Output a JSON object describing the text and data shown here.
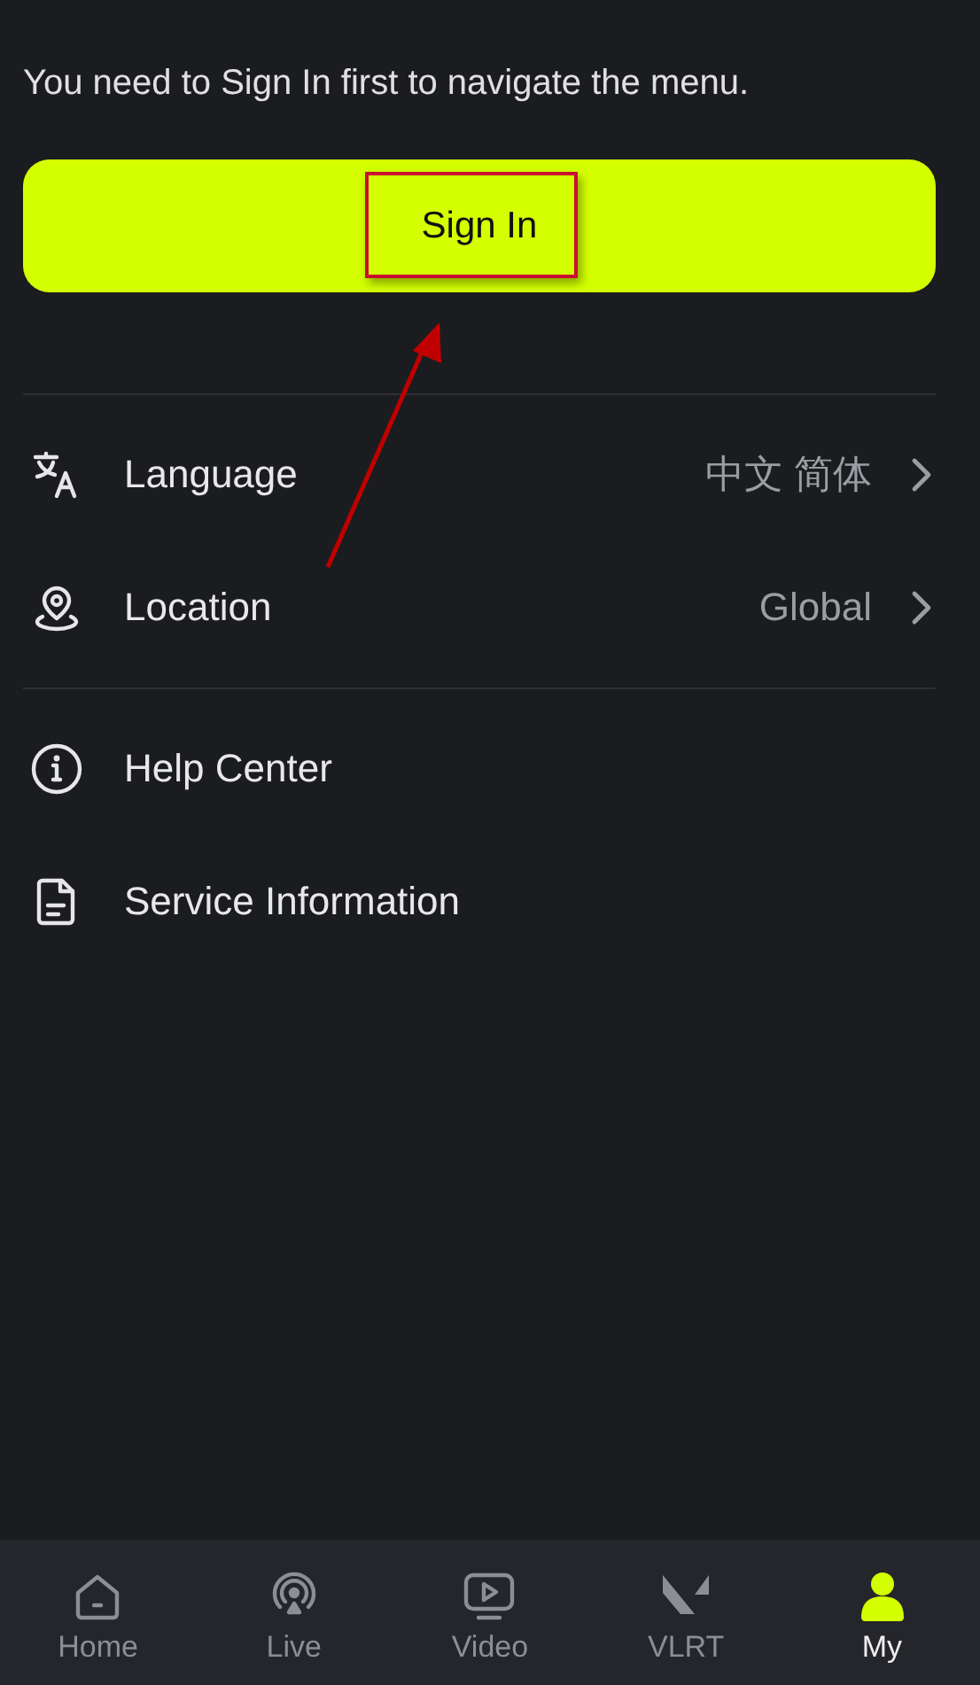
{
  "notice": "You need to Sign In first to navigate the menu.",
  "sign_in_button": {
    "label": "Sign In"
  },
  "menu_groups": [
    [
      {
        "kind": "language",
        "label": "Language",
        "value": "中文 简体"
      },
      {
        "kind": "location",
        "label": "Location",
        "value": "Global"
      }
    ],
    [
      {
        "kind": "help",
        "label": "Help Center"
      },
      {
        "kind": "document",
        "label": "Service Information"
      }
    ]
  ],
  "bottom_nav": [
    {
      "kind": "home",
      "label": "Home",
      "selected": false
    },
    {
      "kind": "live",
      "label": "Live",
      "selected": false
    },
    {
      "kind": "video",
      "label": "Video",
      "selected": false
    },
    {
      "kind": "vlrt",
      "label": "VLRT",
      "selected": false
    },
    {
      "kind": "my",
      "label": "My",
      "selected": true
    }
  ]
}
